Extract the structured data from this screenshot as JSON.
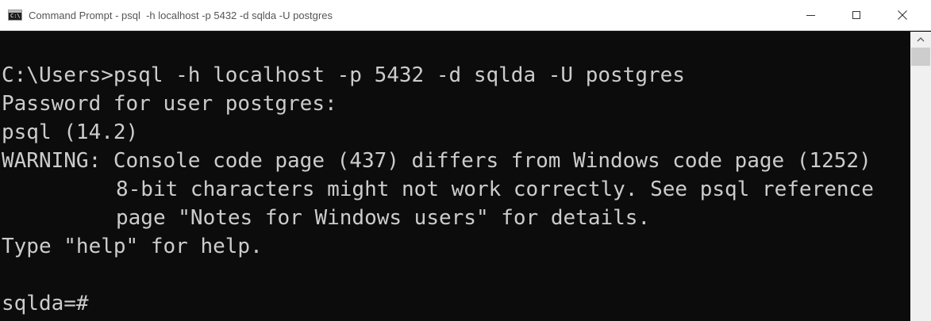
{
  "window": {
    "title": "Command Prompt - psql  -h localhost -p 5432 -d sqlda -U postgres",
    "icon": "cmd-icon",
    "icon_text": "C:\\"
  },
  "controls": {
    "minimize_icon": "minimize-icon",
    "maximize_icon": "maximize-icon",
    "close_icon": "close-icon"
  },
  "console": {
    "lines": [
      "",
      "C:\\Users>psql -h localhost -p 5432 -d sqlda -U postgres",
      "Password for user postgres:",
      "psql (14.2)",
      "WARNING: Console code page (437) differs from Windows code page (1252)",
      "8-bit characters might not work correctly. See psql reference",
      "page \"Notes for Windows users\" for details.",
      "Type \"help\" for help.",
      "",
      "sqlda=#"
    ],
    "text_color": "#cccccc",
    "background_color": "#0c0c0c"
  },
  "scrollbar": {
    "up_arrow_icon": "scroll-up-arrow-icon"
  }
}
